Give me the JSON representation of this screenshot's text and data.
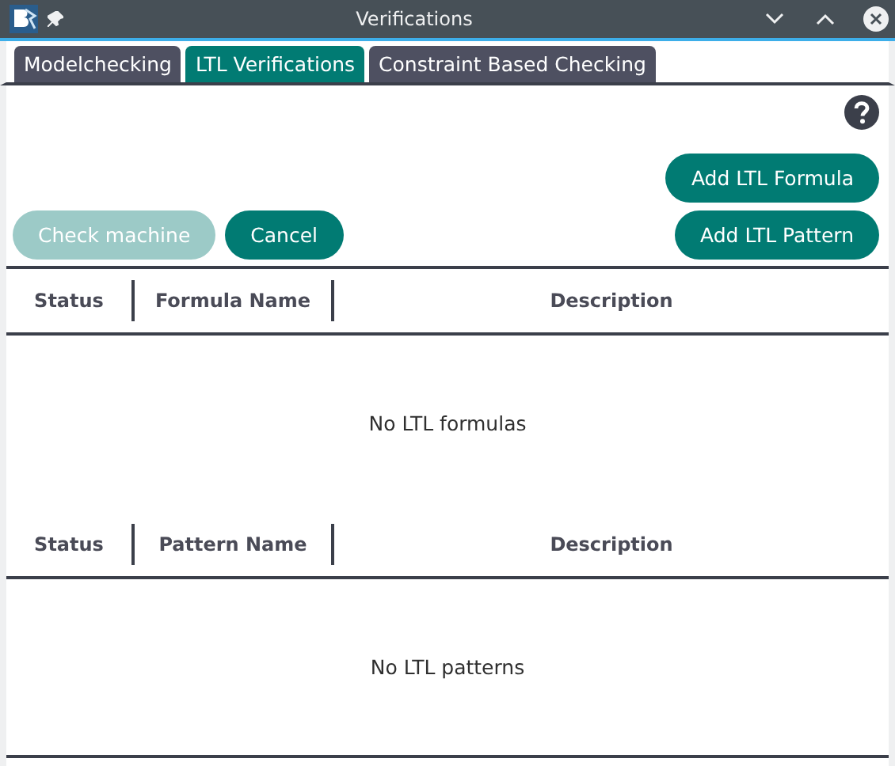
{
  "window": {
    "title": "Verifications"
  },
  "tabs": [
    {
      "label": "Modelchecking",
      "selected": false
    },
    {
      "label": "LTL Verifications",
      "selected": true
    },
    {
      "label": "Constraint Based Checking",
      "selected": false
    }
  ],
  "buttons": {
    "add_formula": {
      "label": "Add LTL Formula",
      "disabled": false
    },
    "add_pattern": {
      "label": "Add LTL Pattern",
      "disabled": false
    },
    "check_machine": {
      "label": "Check machine",
      "disabled": true
    },
    "cancel": {
      "label": "Cancel",
      "disabled": false
    }
  },
  "formulas_table": {
    "columns": [
      "Status",
      "Formula Name",
      "Description"
    ],
    "empty_text": "No LTL formulas",
    "top_border": true
  },
  "patterns_table": {
    "columns": [
      "Status",
      "Pattern Name",
      "Description"
    ],
    "empty_text": "No LTL patterns",
    "top_border": false
  }
}
